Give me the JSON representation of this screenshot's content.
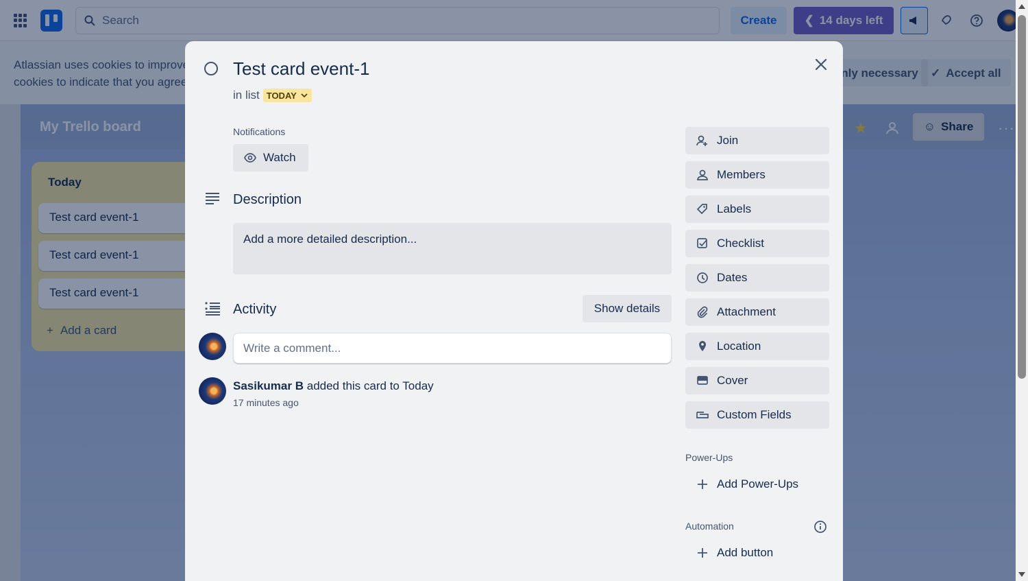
{
  "topbar": {
    "search_placeholder": "Search",
    "create_label": "Create",
    "trial_label": "14 days left"
  },
  "cookie_banner": {
    "text_line1": "Atlassian uses cookies to improve",
    "text_line2": "cookies to indicate that you agree",
    "only_necessary_label": "Only necessary",
    "accept_all_label": "Accept all"
  },
  "board": {
    "title": "My Trello board",
    "share_label": "Share",
    "list": {
      "title": "Today",
      "cards": [
        "Test card event-1",
        "Test card event-1",
        "Test card event-1"
      ],
      "add_card_label": "Add a card"
    }
  },
  "card": {
    "title": "Test card event-1",
    "in_list_prefix": "in list",
    "list_name": "TODAY",
    "notifications_label": "Notifications",
    "watch_label": "Watch",
    "description_title": "Description",
    "description_placeholder": "Add a more detailed description...",
    "activity_title": "Activity",
    "show_details_label": "Show details",
    "comment_placeholder": "Write a comment...",
    "activity_entry": {
      "user": "Sasikumar B",
      "action": "added this card to Today",
      "time": "17 minutes ago"
    }
  },
  "sidebar": {
    "buttons": [
      {
        "label": "Join",
        "icon": "join-icon"
      },
      {
        "label": "Members",
        "icon": "person-icon"
      },
      {
        "label": "Labels",
        "icon": "tag-icon"
      },
      {
        "label": "Checklist",
        "icon": "checkbox-icon"
      },
      {
        "label": "Dates",
        "icon": "clock-icon"
      },
      {
        "label": "Attachment",
        "icon": "paperclip-icon"
      },
      {
        "label": "Location",
        "icon": "pin-icon"
      },
      {
        "label": "Cover",
        "icon": "cover-icon"
      },
      {
        "label": "Custom Fields",
        "icon": "field-icon"
      }
    ],
    "powerups_title": "Power-Ups",
    "add_powerups_label": "Add Power-Ups",
    "automation_title": "Automation",
    "add_button_label": "Add button"
  },
  "colors": {
    "overlay": "#091e427a",
    "list_chip": "#f8e6a0",
    "modal_bg": "#f1f2f4",
    "trial": "#6e5dc6"
  }
}
